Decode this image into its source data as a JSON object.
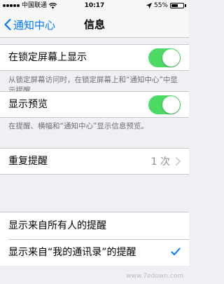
{
  "status_bar": {
    "carrier": "中国联通",
    "time": "10:17",
    "battery": "55%",
    "battery_level": 0.55
  },
  "nav": {
    "back_label": "通知中心",
    "title": "信息"
  },
  "settings": {
    "lock_screen": {
      "label": "在锁定屏幕上显示",
      "enabled": true,
      "note": "从锁定屏幕访问时，在锁定屏幕上和“通知中心”中显示提醒。"
    },
    "preview": {
      "label": "显示预览",
      "enabled": true,
      "note": "在提醒、横幅和“通知中心”显示信息预览。"
    },
    "repeat": {
      "label": "重复提醒",
      "value": "1 次"
    },
    "alerts_from": {
      "options": [
        {
          "label": "显示来自所有人的提醒",
          "selected": false
        },
        {
          "label": "显示来自“我的通讯录”的提醒",
          "selected": true
        }
      ]
    }
  },
  "colors": {
    "accent": "#007aff",
    "toggle_on": "#4cd964"
  },
  "watermark": "www.7edown.com"
}
